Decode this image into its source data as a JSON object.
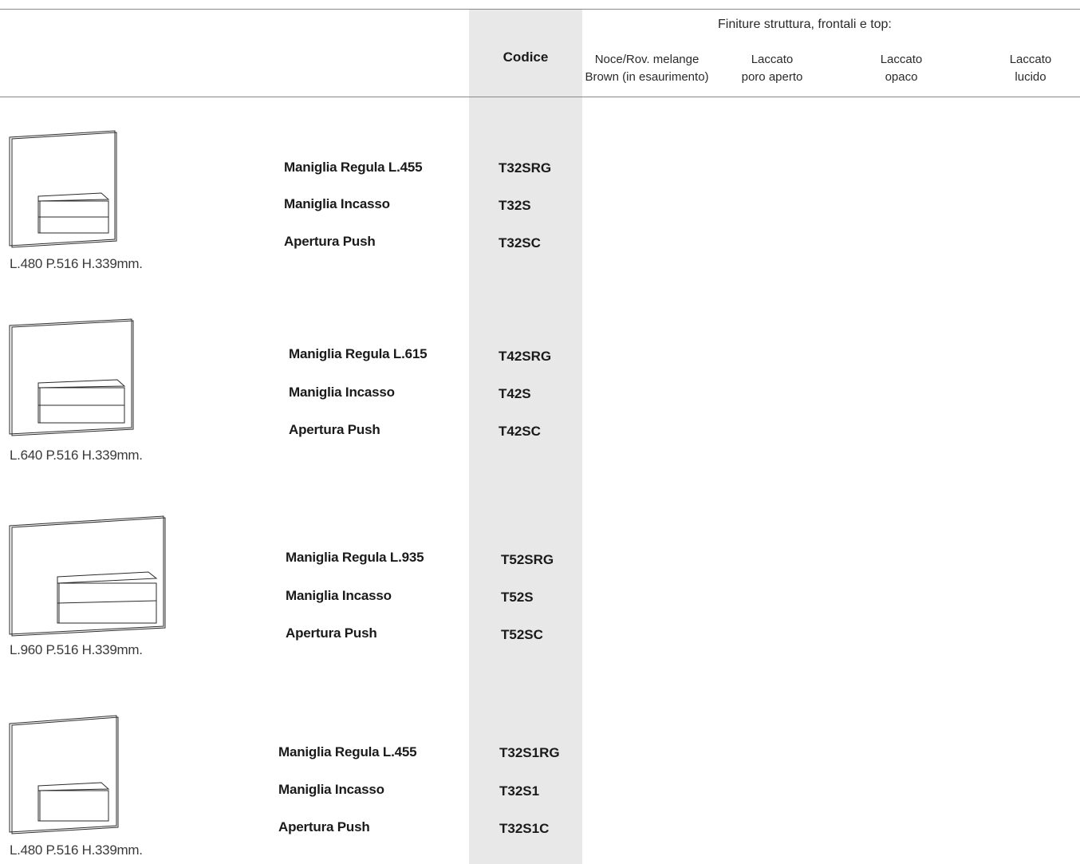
{
  "header": {
    "finiture_label": "Finiture struttura, frontali e top:",
    "codice_label": "Codice",
    "columns": [
      {
        "line1": "Noce/Rov. melange",
        "line2": "Brown (in esaurimento)"
      },
      {
        "line1": "Laccato",
        "line2": "poro aperto"
      },
      {
        "line1": "Laccato",
        "line2": "opaco"
      },
      {
        "line1": "Laccato",
        "line2": "lucido"
      }
    ]
  },
  "products": [
    {
      "dims": "L.480  P.516  H.339mm.",
      "drawers": 2,
      "rows": [
        {
          "label": "Maniglia Regula L.455",
          "code": "T32SRG"
        },
        {
          "label": "Maniglia Incasso",
          "code": "T32S"
        },
        {
          "label": "Apertura Push",
          "code": "T32SC"
        }
      ]
    },
    {
      "dims": "L.640  P.516  H.339mm.",
      "drawers": 2,
      "rows": [
        {
          "label": "Maniglia Regula L.615",
          "code": "T42SRG"
        },
        {
          "label": "Maniglia Incasso",
          "code": "T42S"
        },
        {
          "label": "Apertura Push",
          "code": "T42SC"
        }
      ]
    },
    {
      "dims": "L.960  P.516  H.339mm.",
      "drawers": 2,
      "rows": [
        {
          "label": "Maniglia Regula L.935",
          "code": "T52SRG"
        },
        {
          "label": "Maniglia Incasso",
          "code": "T52S"
        },
        {
          "label": "Apertura Push",
          "code": "T52SC"
        }
      ]
    },
    {
      "dims": "L.480  P.516  H.339mm.",
      "drawers": 1,
      "rows": [
        {
          "label": "Maniglia Regula L.455",
          "code": "T32S1RG"
        },
        {
          "label": "Maniglia Incasso",
          "code": "T32S1"
        },
        {
          "label": "Apertura Push",
          "code": "T32S1C"
        }
      ]
    }
  ]
}
